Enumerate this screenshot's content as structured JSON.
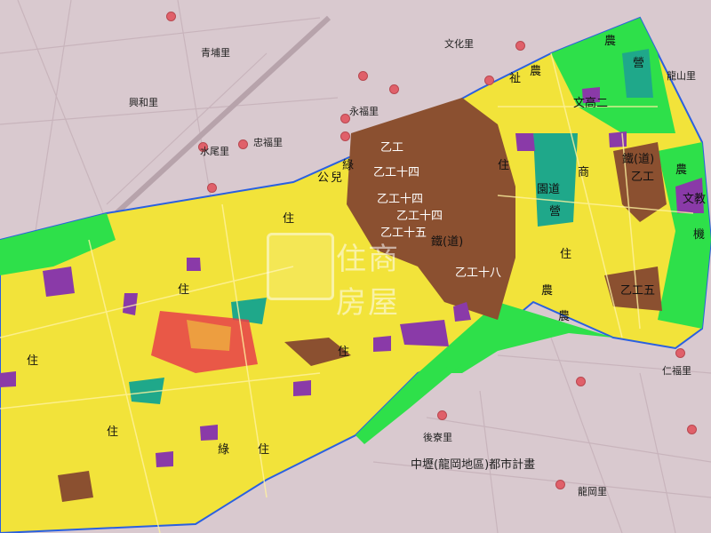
{
  "map": {
    "title": "中壢(龍岡地區)都市計畫",
    "watermark": "住商房屋",
    "colors": {
      "background": "#d9c9cf",
      "residential": "#f2e33a",
      "commercial": "#e8404a",
      "industrial": "#8b5030",
      "agricultural": "#2ee04a",
      "institutional": "#8a3aa8",
      "park": "#1fa88a",
      "boundary": "#2a60e0",
      "village_dot": "#e0606a"
    },
    "district_labels": [
      {
        "id": "qingpu",
        "text": "青埔里"
      },
      {
        "id": "xingfu",
        "text": "興和里"
      },
      {
        "id": "yongfu",
        "text": "永福里"
      },
      {
        "id": "xiaofu",
        "text": "忠福里"
      },
      {
        "id": "beiwen",
        "text": "文化里"
      },
      {
        "id": "nanshan",
        "text": "龍山里"
      },
      {
        "id": "xiaoli",
        "text": "水尾里"
      },
      {
        "id": "houliao",
        "text": "後寮里"
      },
      {
        "id": "gangnan",
        "text": "龍岡里"
      },
      {
        "id": "right",
        "text": "仁福里"
      }
    ],
    "zone_labels": [
      {
        "id": "z1",
        "text": "農"
      },
      {
        "id": "z2",
        "text": "農"
      },
      {
        "id": "z3",
        "text": "農"
      },
      {
        "id": "z4",
        "text": "農"
      },
      {
        "id": "z5",
        "text": "農"
      },
      {
        "id": "z6",
        "text": "營"
      },
      {
        "id": "z7",
        "text": "營"
      },
      {
        "id": "z8",
        "text": "乙工十四"
      },
      {
        "id": "z9",
        "text": "乙工十四"
      },
      {
        "id": "z10",
        "text": "乙工十四"
      },
      {
        "id": "z11",
        "text": "乙工十五"
      },
      {
        "id": "z12",
        "text": "乙工十八"
      },
      {
        "id": "z13",
        "text": "乙工"
      },
      {
        "id": "z14",
        "text": "乙工"
      },
      {
        "id": "z15",
        "text": "乙工五"
      },
      {
        "id": "z16",
        "text": "鐵(道)"
      },
      {
        "id": "z17",
        "text": "鐵(道)"
      },
      {
        "id": "z18",
        "text": "文高二"
      },
      {
        "id": "z19",
        "text": "文教"
      },
      {
        "id": "z20",
        "text": "園道"
      },
      {
        "id": "z21",
        "text": "商"
      },
      {
        "id": "z22",
        "text": "住"
      },
      {
        "id": "z23",
        "text": "住"
      },
      {
        "id": "z24",
        "text": "住"
      },
      {
        "id": "z25",
        "text": "住"
      },
      {
        "id": "z26",
        "text": "住"
      },
      {
        "id": "z27",
        "text": "住"
      },
      {
        "id": "z28",
        "text": "住"
      },
      {
        "id": "z29",
        "text": "住"
      },
      {
        "id": "z30",
        "text": "綠"
      },
      {
        "id": "z31",
        "text": "綠"
      },
      {
        "id": "z32",
        "text": "兒"
      },
      {
        "id": "z33",
        "text": "祉"
      },
      {
        "id": "z34",
        "text": "機"
      },
      {
        "id": "z35",
        "text": "公"
      }
    ]
  }
}
